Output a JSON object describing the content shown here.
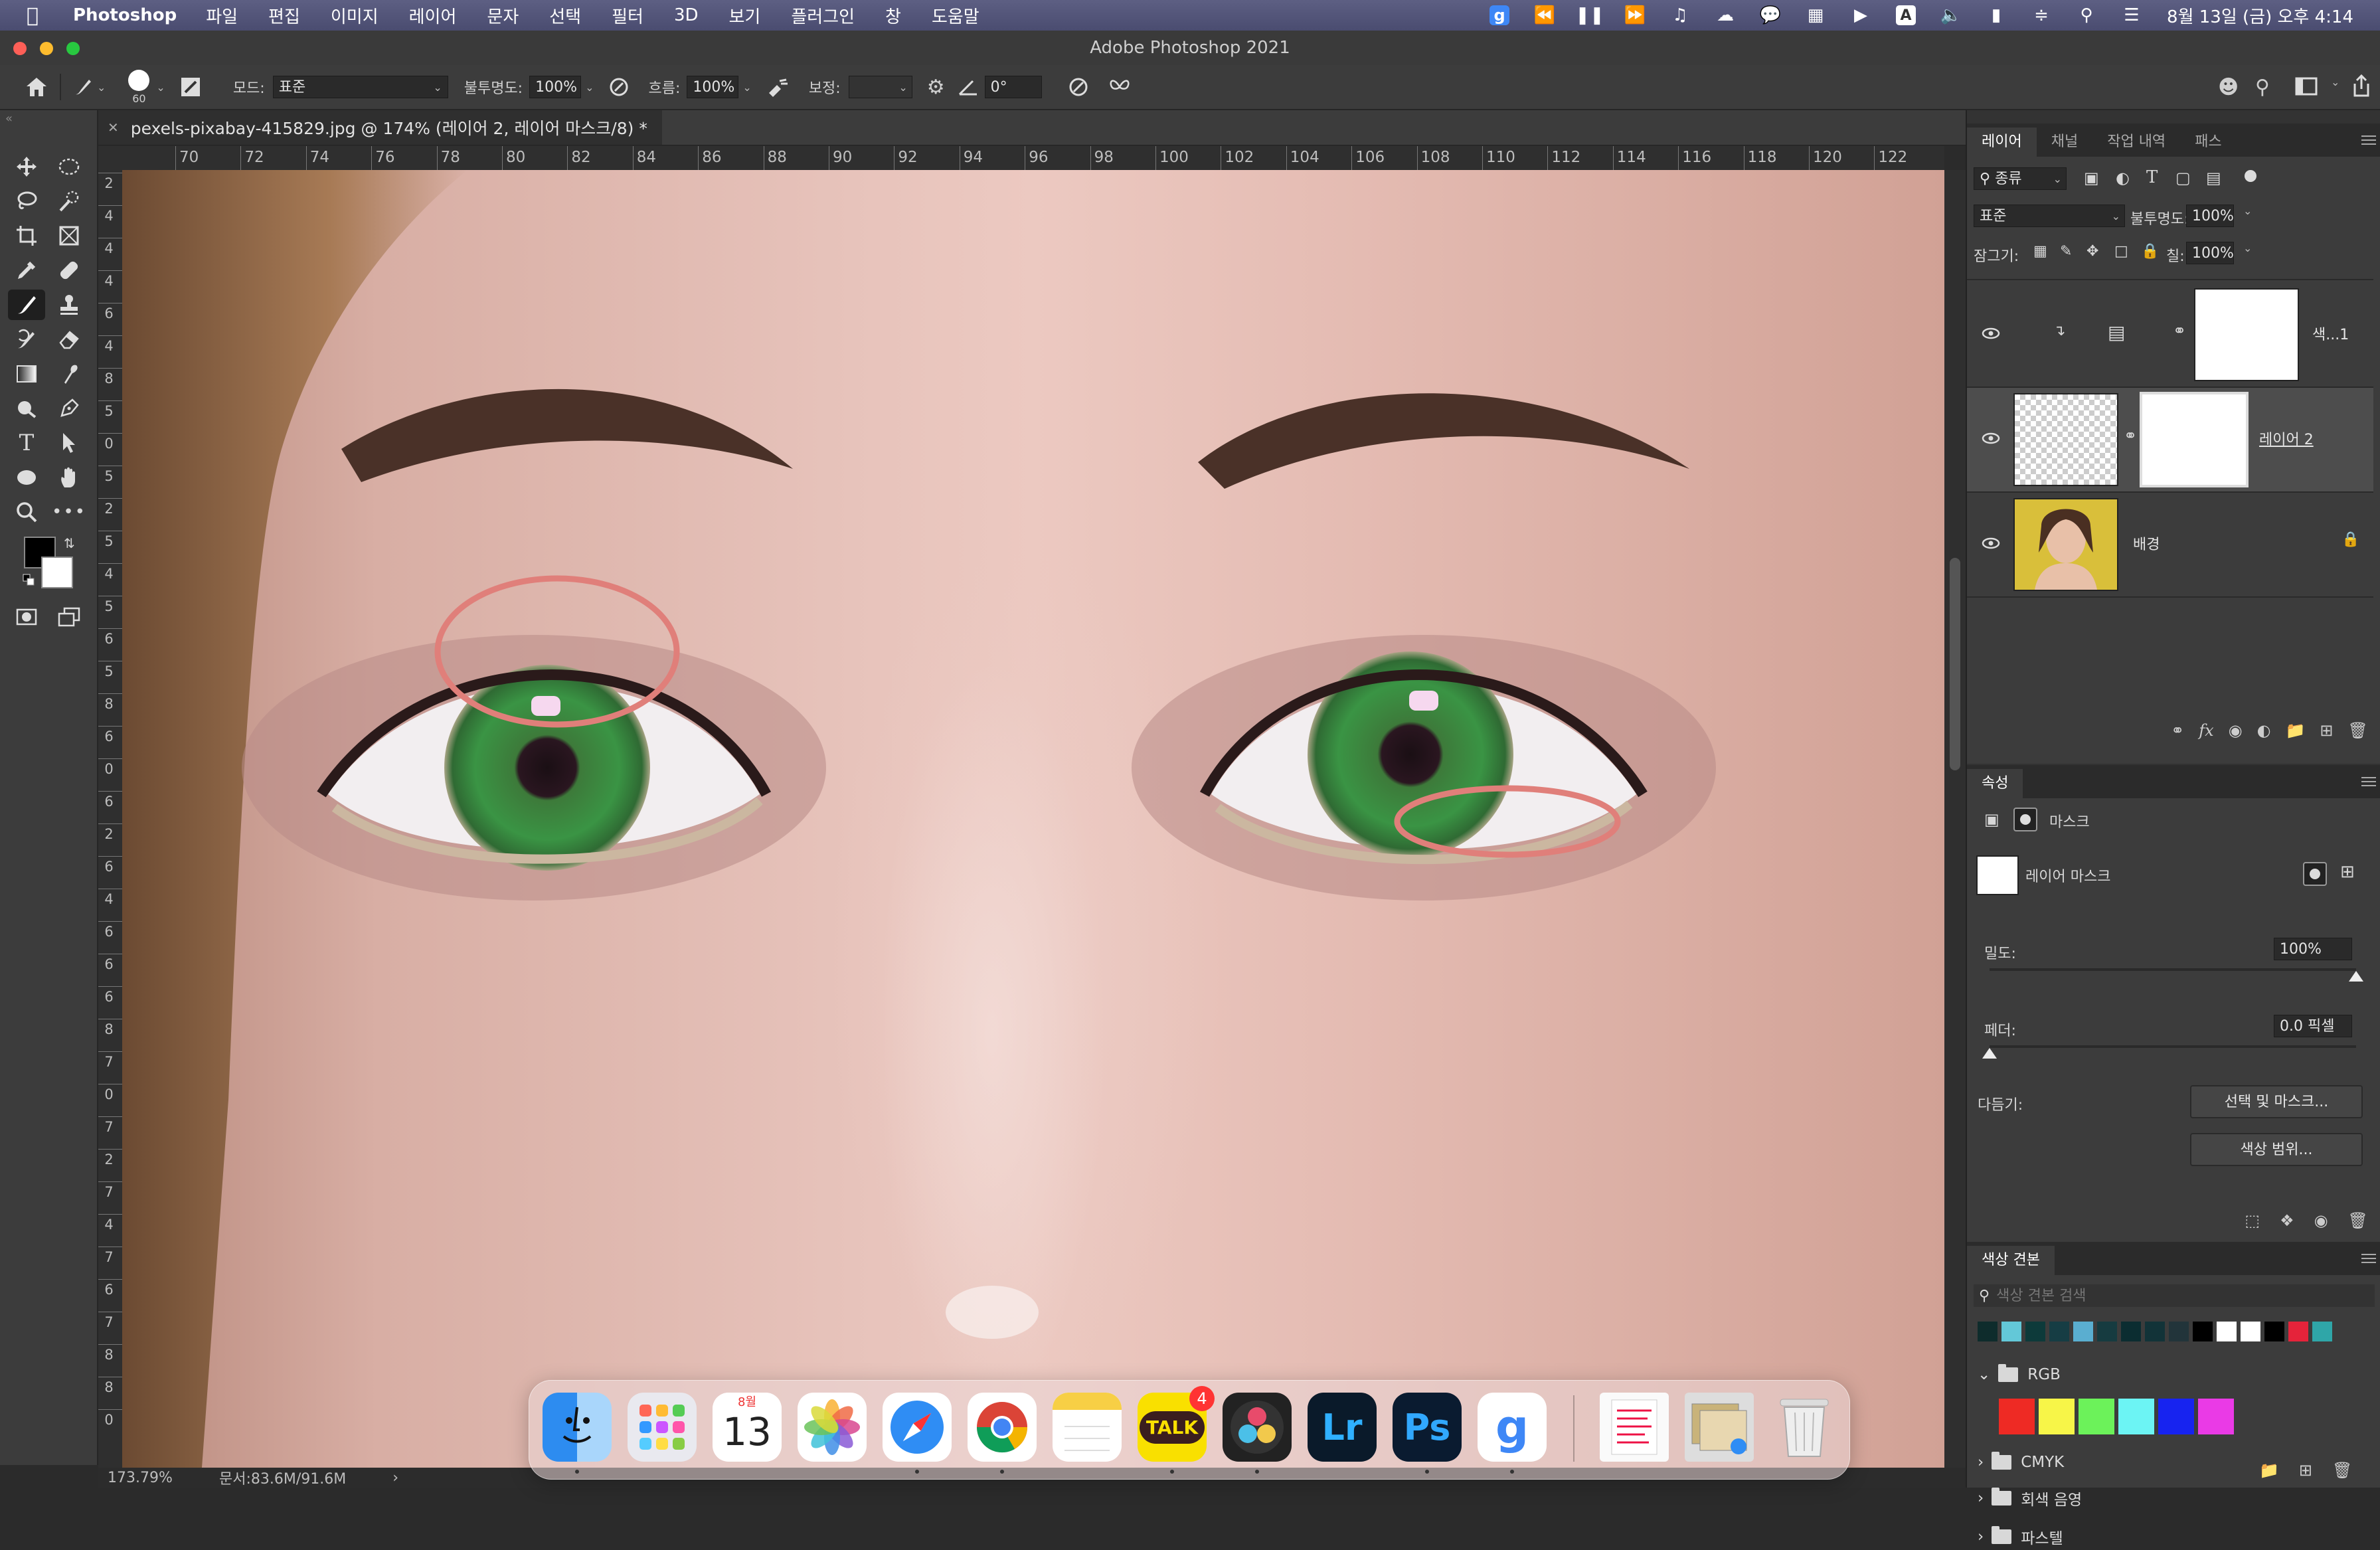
{
  "menubar": {
    "app_name": "Photoshop",
    "items": [
      "파일",
      "편집",
      "이미지",
      "레이어",
      "문자",
      "선택",
      "필터",
      "3D",
      "보기",
      "플러그인",
      "창",
      "도움말"
    ],
    "datetime": "8월 13일 (금) 오후 4:14",
    "status_g": "g",
    "status_a": "A"
  },
  "window": {
    "title": "Adobe Photoshop 2021"
  },
  "options_bar": {
    "brush_size": "60",
    "mode_label": "모드:",
    "mode_value": "표준",
    "opacity_label": "불투명도:",
    "opacity_value": "100%",
    "flow_label": "흐름:",
    "flow_value": "100%",
    "smoothing_label": "보정:",
    "smoothing_value": "",
    "angle_value": "0°"
  },
  "document": {
    "tab_title": "pexels-pixabay-415829.jpg @ 174% (레이어 2, 레이어 마스크/8) *",
    "ruler_h": [
      "70",
      "72",
      "74",
      "76",
      "78",
      "80",
      "82",
      "84",
      "86",
      "88",
      "90",
      "92",
      "94",
      "96",
      "98",
      "100",
      "102",
      "104",
      "106",
      "108",
      "110",
      "112",
      "114",
      "116",
      "118",
      "120",
      "122"
    ],
    "ruler_v": [
      "2",
      "4",
      "4",
      "4",
      "6",
      "4",
      "8",
      "5",
      "0",
      "5",
      "2",
      "5",
      "4",
      "5",
      "6",
      "5",
      "8",
      "6",
      "0",
      "6",
      "2",
      "6",
      "4",
      "6",
      "6",
      "6",
      "8",
      "7",
      "0",
      "7",
      "2",
      "7",
      "4",
      "7",
      "6",
      "7",
      "8",
      "8",
      "0"
    ],
    "zoom": "173.79%",
    "doc_size": "문서:83.6M/91.6M"
  },
  "layers_panel": {
    "tabs": [
      "레이어",
      "채널",
      "작업 내역",
      "패스"
    ],
    "filter_kind": "종류",
    "blend_mode": "표준",
    "opacity_label": "불투명도:",
    "opacity_value": "100%",
    "lock_label": "잠그기:",
    "fill_label": "칠:",
    "fill_value": "100%",
    "layers": [
      {
        "name": "색...1"
      },
      {
        "name": "레이어 2"
      },
      {
        "name": "배경"
      }
    ]
  },
  "properties_panel": {
    "title": "속성",
    "mask_label": "마스크",
    "layer_mask_label": "레이어 마스크",
    "density_label": "밀도:",
    "density_value": "100%",
    "density_level": 1.0,
    "feather_label": "페더:",
    "feather_value": "0.0 픽셀",
    "feather_level": 0.0,
    "refine_label": "다듬기:",
    "select_mask_button": "선택 및 마스크...",
    "color_range_button": "색상 범위..."
  },
  "swatches_panel": {
    "title": "색상 견본",
    "search_placeholder": "색상 견본 검색",
    "recent_colors": [
      "#0e2c2c",
      "#63c8d8",
      "#0d3a3a",
      "#163d44",
      "#5aaed0",
      "#163b40",
      "#0b2d31",
      "#123338",
      "#22343a",
      "#000000",
      "#ffffff",
      "#ffffff",
      "#000000",
      "#e5233a",
      "#2fa6a8"
    ],
    "groups": [
      {
        "name": "RGB",
        "open": true
      },
      {
        "name": "CMYK",
        "open": false
      },
      {
        "name": "회색 음영",
        "open": false
      },
      {
        "name": "파스텔",
        "open": false
      }
    ],
    "rgb_colors": [
      "#ee2a24",
      "#f7f548",
      "#6cf25a",
      "#6cf4f4",
      "#1723f0",
      "#ea3ae6"
    ]
  },
  "dock": {
    "calendar_month": "8월",
    "calendar_day": "13",
    "kakao_label": "TALK",
    "kakao_badge": "4",
    "lr_label": "Lr",
    "ps_label": "Ps",
    "g_label": "g"
  },
  "colors": {
    "menubar": "#4f5176",
    "annotation_ellipse": "#e07f7a",
    "panel_bg": "#3c3c3c"
  }
}
